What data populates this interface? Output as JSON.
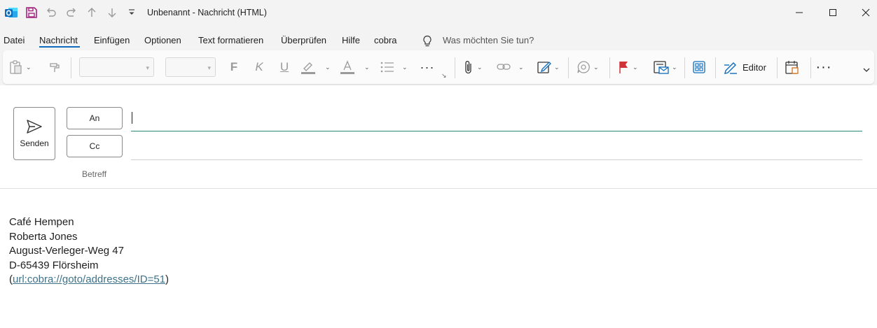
{
  "window": {
    "title": "Unbenannt  -  Nachricht (HTML)"
  },
  "colors": {
    "accent": "#0f6cbd",
    "app_icon": "#0f6cbd",
    "save_icon": "#a4237f",
    "flag": "#d13438",
    "field_focus": "#2b8a7e",
    "link": "#3e7389"
  },
  "quick_access": {
    "icons": [
      "outlook-app-icon",
      "save-icon",
      "undo-icon",
      "redo-icon",
      "up-arrow-icon",
      "down-arrow-icon",
      "customize-qat-icon"
    ]
  },
  "menu": {
    "tabs": [
      "Datei",
      "Nachricht",
      "Einfügen",
      "Optionen",
      "Text formatieren",
      "Überprüfen",
      "Hilfe",
      "cobra"
    ],
    "active_tab": "Nachricht",
    "tell_me_placeholder": "Was möchten Sie tun?"
  },
  "ribbon": {
    "font_name": "",
    "font_size": "",
    "bold": "F",
    "italic": "K",
    "underline": "U",
    "editor_label": "Editor"
  },
  "compose": {
    "send_label": "Senden",
    "to_label": "An",
    "cc_label": "Cc",
    "subject_label": "Betreff",
    "to_value": "",
    "cc_value": ""
  },
  "body": {
    "lines": [
      "Café Hempen",
      "Roberta Jones",
      "August-Verleger-Weg 47",
      "D-65439 Flörsheim"
    ],
    "link_prefix": "(",
    "link_text": "url:cobra://goto/addresses/ID=51",
    "link_suffix": ")"
  }
}
